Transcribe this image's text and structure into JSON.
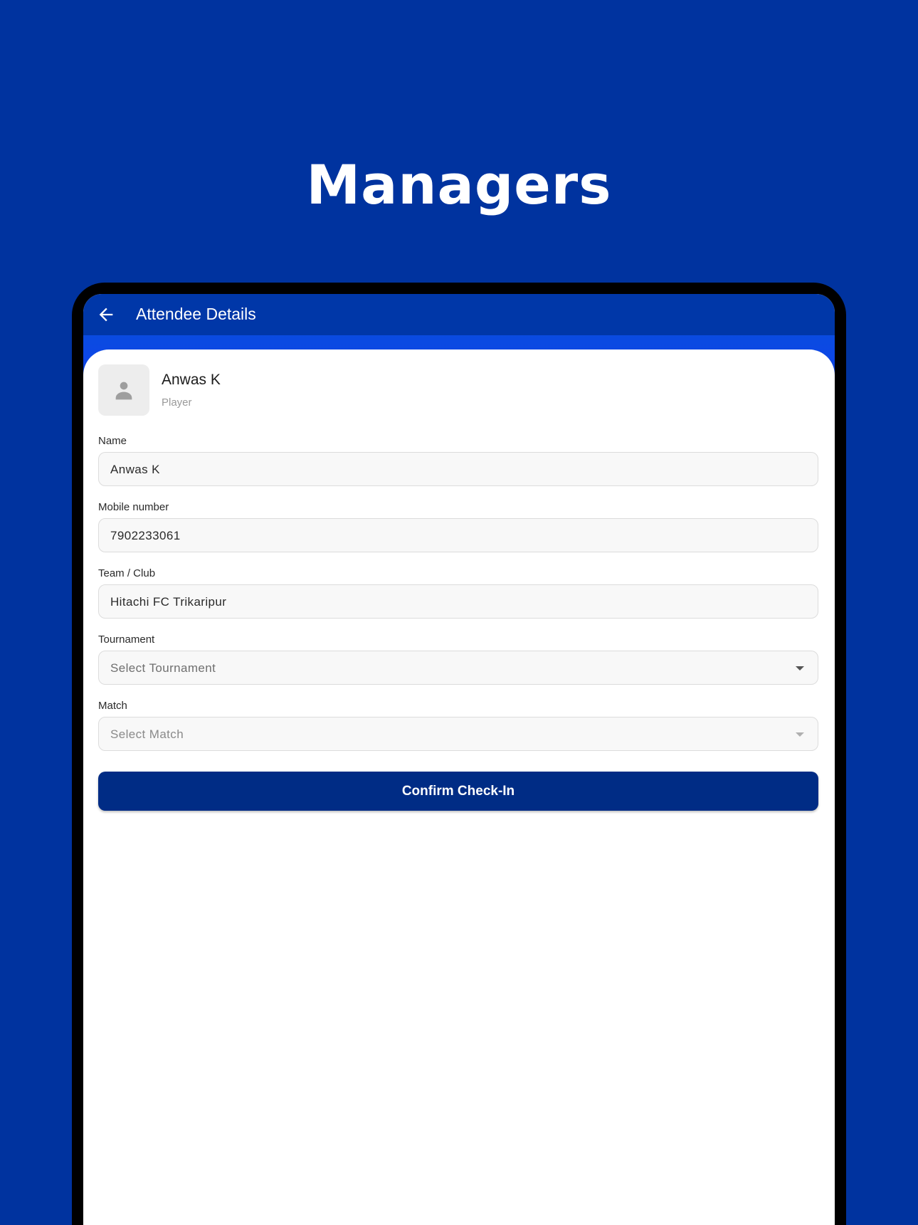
{
  "headline": "Managers",
  "colors": {
    "background": "#00339F",
    "app_bar": "#0037A8",
    "primary_button": "#002C85"
  },
  "app_bar": {
    "back_icon": "arrow-left-icon",
    "title": "Attendee Details"
  },
  "profile": {
    "avatar_icon": "person-icon",
    "name": "Anwas K",
    "role": "Player"
  },
  "form": {
    "name": {
      "label": "Name",
      "value": "Anwas K"
    },
    "mobile": {
      "label": "Mobile number",
      "value": "7902233061"
    },
    "team": {
      "label": "Team / Club",
      "value": "Hitachi FC Trikaripur"
    },
    "tournament": {
      "label": "Tournament",
      "placeholder": "Select Tournament",
      "icon": "caret-down-icon"
    },
    "match": {
      "label": "Match",
      "placeholder": "Select Match",
      "icon": "caret-down-icon",
      "disabled": true
    }
  },
  "confirm_button": {
    "label": "Confirm Check-In"
  }
}
